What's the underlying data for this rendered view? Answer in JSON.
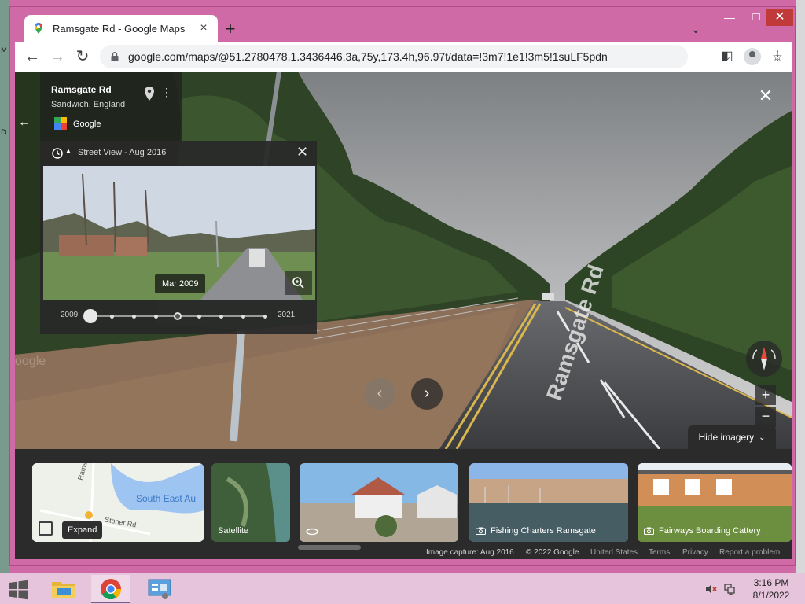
{
  "desktop": {
    "left_letters": [
      "M",
      "D"
    ]
  },
  "browser": {
    "tab": {
      "title": "Ramsgate Rd - Google Maps",
      "close": "×"
    },
    "new_tab": "+",
    "tab_search": "⌄",
    "window_controls": {
      "minimize": "—",
      "maximize": "❐",
      "close": "✕"
    },
    "nav": {
      "back": "←",
      "forward": "→",
      "reload": "↻"
    },
    "url": "google.com/maps/@51.2780478,1.3436446,3a,75y,173.4h,96.97t/data=!3m7!1e1!3m5!1suLF5pdnSA_t...",
    "omnibox_icons": {
      "install": "⤓",
      "share": "⇪",
      "bookmark": "☆"
    },
    "toolbar_icons": {
      "side_panel": "◧",
      "menu": "⋮"
    }
  },
  "street_view": {
    "place_name": "Ramsgate Rd",
    "place_sub": "Sandwich, England",
    "source": "Google",
    "more": "⋮",
    "back": "←",
    "close": "✕",
    "time_machine": {
      "label": "Street View - Aug 2016",
      "caret": "▲",
      "close": "✕",
      "selected_date": "Mar 2009",
      "year_start": "2009",
      "year_end": "2021",
      "dots": 9,
      "selected_index": 0,
      "current_index": 4
    },
    "road_label": "Ramsgate Rd",
    "watermark": "oogle",
    "nav_prev": "‹",
    "nav_next": "›",
    "zoom_in": "+",
    "zoom_out": "−",
    "hide_imagery": "Hide imagery",
    "hide_chev": "⌄"
  },
  "strip": {
    "mini_map": {
      "area_label": "South East Au",
      "road_a": "Ramsgate Rd",
      "road_b": "Stoner Rd",
      "expand_tooltip": "Expand"
    },
    "satellite_label": "Satellite",
    "photos": [
      {
        "label": ""
      },
      {
        "label": "Fishing Charters Ramsgate"
      },
      {
        "label": "Fairways Boarding Cattery"
      }
    ]
  },
  "attribution": {
    "capture": "Image capture: Aug 2016",
    "copyright": "© 2022 Google",
    "region": "United States",
    "terms": "Terms",
    "privacy": "Privacy",
    "report": "Report a problem"
  },
  "taskbar": {
    "time": "3:16 PM",
    "date": "8/1/2022"
  },
  "colors": {
    "window_frame": "#cf6aa6",
    "close_button": "#c13a3a",
    "panel_bg": "#2b2b2b",
    "taskbar": "#e6c4db"
  }
}
